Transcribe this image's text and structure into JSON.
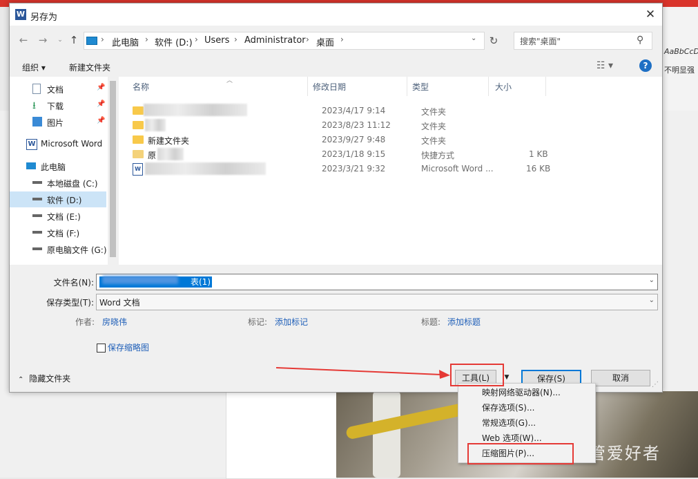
{
  "background": {
    "style_sample": "AaBbCcD",
    "style_label": "不明显强",
    "watermark": "公众号 · 网管爱好者"
  },
  "dialog": {
    "title": "另存为",
    "app_icon_letter": "W",
    "close": "✕"
  },
  "address": {
    "crumbs": [
      "此电脑",
      "软件 (D:)",
      "Users",
      "Administrator",
      "桌面"
    ],
    "search_placeholder": "搜索\"桌面\""
  },
  "toolbar": {
    "organize": "组织 ▾",
    "new_folder": "新建文件夹",
    "view": "☷ ▾",
    "help": "?"
  },
  "nav": {
    "items": [
      {
        "label": "文档",
        "icon": "document-icon"
      },
      {
        "label": "下载",
        "icon": "download-icon"
      },
      {
        "label": "图片",
        "icon": "picture-icon"
      },
      {
        "label": "Microsoft Word",
        "icon": "word-icon"
      },
      {
        "label": "此电脑",
        "icon": "computer-icon"
      },
      {
        "label": "本地磁盘 (C:)",
        "icon": "drive-icon"
      },
      {
        "label": "软件 (D:)",
        "icon": "drive-icon"
      },
      {
        "label": "文档 (E:)",
        "icon": "drive-icon"
      },
      {
        "label": "文档 (F:)",
        "icon": "drive-icon"
      },
      {
        "label": "原电脑文件 (G:)",
        "icon": "drive-icon"
      }
    ]
  },
  "files": {
    "columns": [
      "名称",
      "修改日期",
      "类型",
      "大小"
    ],
    "rows": [
      {
        "name": "",
        "date": "2023/4/17 9:14",
        "type": "文件夹",
        "size": ""
      },
      {
        "name": "",
        "date": "2023/8/23 11:12",
        "type": "文件夹",
        "size": ""
      },
      {
        "name": "新建文件夹",
        "date": "2023/9/27 9:48",
        "type": "文件夹",
        "size": ""
      },
      {
        "name": "原",
        "date": "2023/1/18 9:15",
        "type": "快捷方式",
        "size": "1 KB"
      },
      {
        "name": "",
        "date": "2023/3/21 9:32",
        "type": "Microsoft Word ...",
        "size": "16 KB"
      }
    ]
  },
  "form": {
    "filename_label": "文件名(N):",
    "filename_value": "表(1)",
    "filetype_label": "保存类型(T):",
    "filetype_value": "Word 文档",
    "author_label": "作者:",
    "author_value": "房晓伟",
    "tags_label": "标记:",
    "tags_value": "添加标记",
    "title_label": "标题:",
    "title_value": "添加标题",
    "thumbnail_label": "保存缩略图"
  },
  "footer": {
    "hide_folders": "隐藏文件夹",
    "tools": "工具(L)",
    "save": "保存(S)",
    "cancel": "取消"
  },
  "tools_menu": {
    "items": [
      "映射网络驱动器(N)...",
      "保存选项(S)...",
      "常规选项(G)...",
      "Web 选项(W)...",
      "压缩图片(P)..."
    ]
  },
  "colors": {
    "annotation_red": "#e53935",
    "selection_blue": "#0078d7",
    "link_blue": "#1f5fb8"
  }
}
